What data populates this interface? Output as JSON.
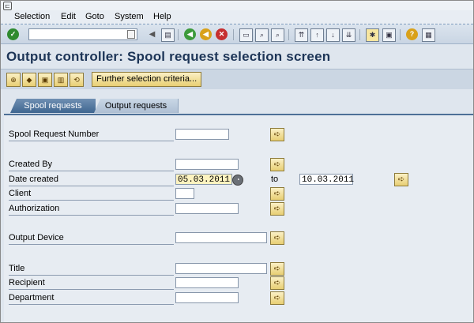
{
  "menu": [
    {
      "label": "Selection"
    },
    {
      "label": "Edit"
    },
    {
      "label": "Goto"
    },
    {
      "label": "System"
    },
    {
      "label": "Help"
    }
  ],
  "toolbar": {
    "command_field_value": ""
  },
  "page_title": "Output controller: Spool request selection screen",
  "app_toolbar": {
    "further_selection_label": "Further selection criteria..."
  },
  "tabs": [
    {
      "label": "Spool requests",
      "active": true
    },
    {
      "label": "Output requests",
      "active": false
    }
  ],
  "form": {
    "spool_request_number": {
      "label": "Spool Request Number",
      "value": ""
    },
    "created_by": {
      "label": "Created By",
      "value": ""
    },
    "date_created": {
      "label": "Date created",
      "from": "05.03.2011",
      "to_label": "to",
      "to": "10.03.2011"
    },
    "client": {
      "label": "Client",
      "value": ""
    },
    "authorization": {
      "label": "Authorization",
      "value": ""
    },
    "output_device": {
      "label": "Output Device",
      "value": ""
    },
    "title": {
      "label": "Title",
      "value": ""
    },
    "recipient": {
      "label": "Recipient",
      "value": ""
    },
    "department": {
      "label": "Department",
      "value": ""
    }
  },
  "colors": {
    "title_text": "#1d3557",
    "active_tab": "#4e7097",
    "highlight_input": "#fdf3c0",
    "button_yellow": "#e8cf74"
  }
}
